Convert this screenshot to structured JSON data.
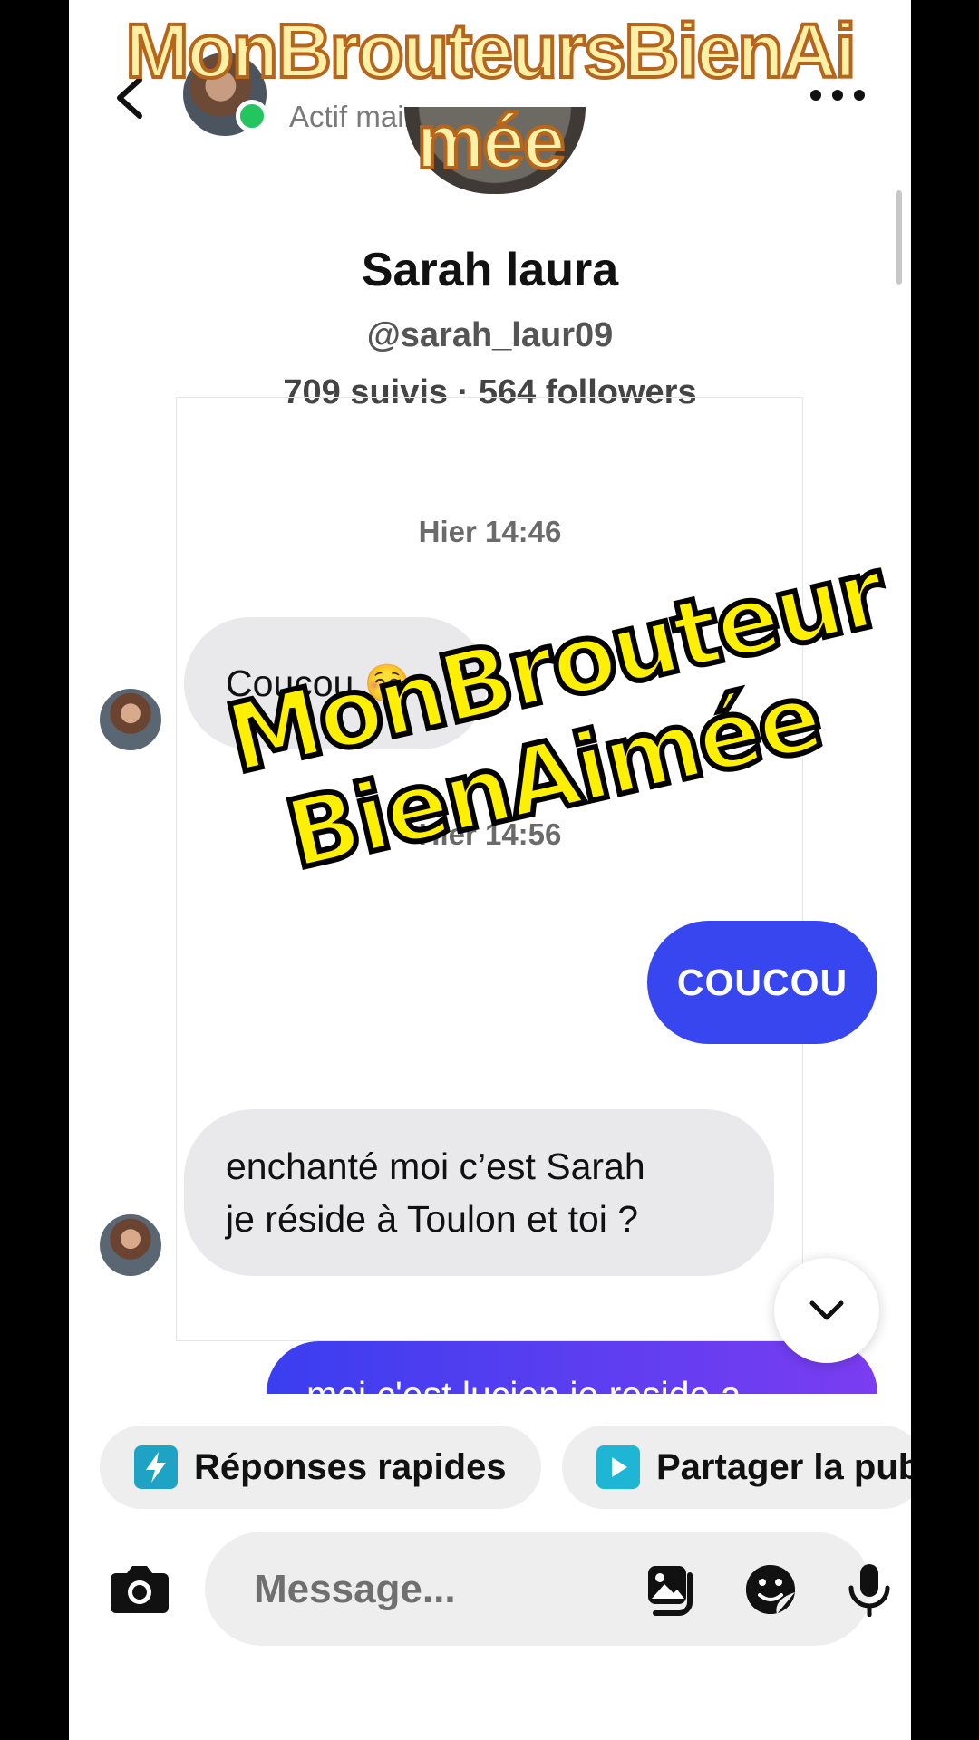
{
  "header": {
    "status": "Actif maintenant"
  },
  "profile": {
    "name": "Sarah laura",
    "handle": "@sarah_laur09",
    "stats": "709 suivis · 564 followers"
  },
  "conversation": {
    "timestamps": [
      "Hier 14:46",
      "Hier 14:56"
    ],
    "messages": [
      {
        "from": "them",
        "text": "Coucou ☺️"
      },
      {
        "from": "me",
        "text": "COUCOU"
      },
      {
        "from": "them",
        "line1": "enchanté moi c’est Sarah",
        "line2": "je réside à Toulon et toi ?"
      },
      {
        "from": "me",
        "text": "moi c'est lucien je reside a"
      }
    ]
  },
  "quick_chips": [
    {
      "label": "Réponses rapides",
      "color": "#1fa3c4"
    },
    {
      "label": "Partager la pub",
      "color": "#1fb6d6"
    }
  ],
  "composer": {
    "placeholder": "Message..."
  },
  "watermarks": {
    "top": [
      "MonBrouteursBienAi",
      "mée"
    ],
    "center": [
      "MonBrouteur",
      "BienAimée"
    ]
  },
  "colors": {
    "outgoing_bubble": "#3846ef",
    "incoming_bubble": "#e9e9eb",
    "online": "#22c55e"
  }
}
